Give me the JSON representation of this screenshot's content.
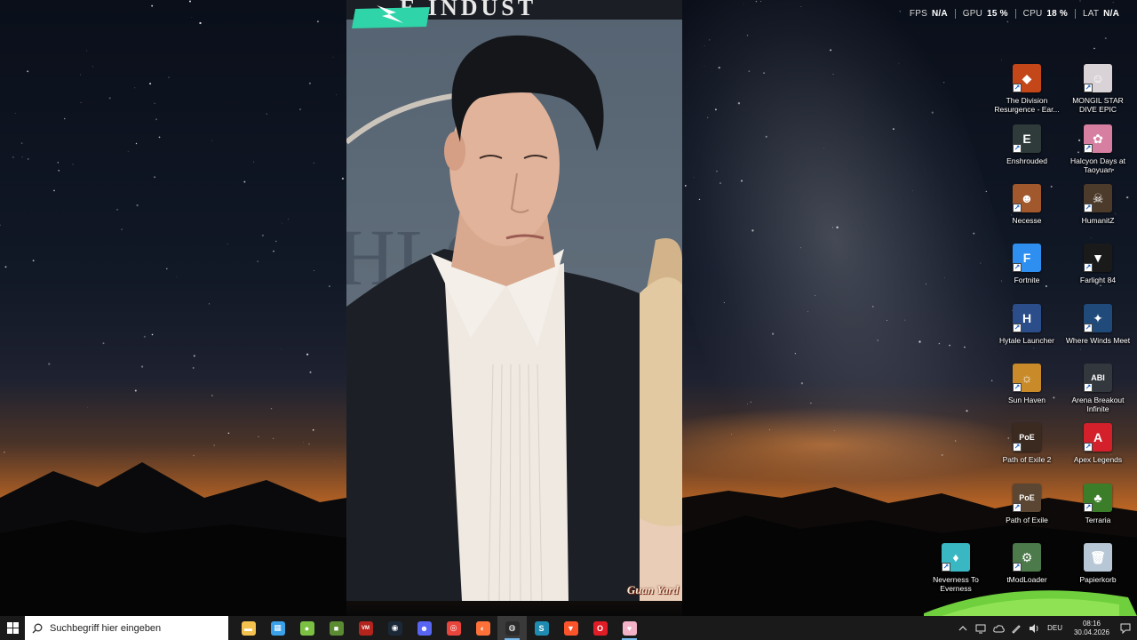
{
  "overlay": {
    "items": [
      {
        "label": "FPS",
        "value": "N/A"
      },
      {
        "label": "GPU",
        "value": "15 %"
      },
      {
        "label": "CPU",
        "value": "18 %"
      },
      {
        "label": "LAT",
        "value": "N/A"
      }
    ]
  },
  "video": {
    "banner_text": "E INDUST",
    "watermark": "Guan Yard"
  },
  "desktop_icons": [
    {
      "name": "the-division-resurgence",
      "label": "The Division Resurgence - Ear...",
      "icon": "division-icon",
      "color": "#c4471a",
      "glyph": "◆"
    },
    {
      "name": "mongil-star-dive",
      "label": "MONGIL STAR DIVE EPIC",
      "icon": "mongil-icon",
      "color": "#d9d2d6",
      "glyph": "☺"
    },
    {
      "name": "enshrouded",
      "label": "Enshrouded",
      "icon": "enshrouded-icon",
      "color": "#2e3b3a",
      "glyph": "E"
    },
    {
      "name": "halcyon-days",
      "label": "Halcyon Days at Taoyuan",
      "icon": "halcyon-icon",
      "color": "#d77fa1",
      "glyph": "✿"
    },
    {
      "name": "necesse",
      "label": "Necesse",
      "icon": "necesse-icon",
      "color": "#a0582c",
      "glyph": "☻"
    },
    {
      "name": "humanitz",
      "label": "HumanitZ",
      "icon": "humanitz-icon",
      "color": "#4c3a2a",
      "glyph": "☠"
    },
    {
      "name": "fortnite",
      "label": "Fortnite",
      "icon": "fortnite-icon",
      "color": "#2f8ff0",
      "glyph": "F"
    },
    {
      "name": "farlight-84",
      "label": "Farlight 84",
      "icon": "farlight-icon",
      "color": "#1a1a1a",
      "glyph": "▼"
    },
    {
      "name": "hytale-launcher",
      "label": "Hytale Launcher",
      "icon": "hytale-icon",
      "color": "#2b4d8a",
      "glyph": "H"
    },
    {
      "name": "where-winds-meet",
      "label": "Where Winds Meet",
      "icon": "where-winds-meet-icon",
      "color": "#1f4a7a",
      "glyph": "✦"
    },
    {
      "name": "sun-haven",
      "label": "Sun Haven",
      "icon": "sun-haven-icon",
      "color": "#c98b2a",
      "glyph": "☼"
    },
    {
      "name": "arena-breakout-infinite",
      "label": "Arena Breakout Infinite",
      "icon": "arena-breakout-icon",
      "color": "#33383f",
      "glyph": "ABI"
    },
    {
      "name": "path-of-exile-2",
      "label": "Path of Exile 2",
      "icon": "poe2-icon",
      "color": "#3b2a20",
      "glyph": "PoE"
    },
    {
      "name": "apex-legends",
      "label": "Apex Legends",
      "icon": "apex-icon",
      "color": "#d3202a",
      "glyph": "A"
    },
    {
      "name": "path-of-exile",
      "label": "Path of Exile",
      "icon": "poe-icon",
      "color": "#5a4632",
      "glyph": "PoE"
    },
    {
      "name": "terraria",
      "label": "Terraria",
      "icon": "terraria-icon",
      "color": "#3c7d2a",
      "glyph": "♣"
    },
    {
      "name": "neverness-to-everness",
      "label": "Neverness To Everness",
      "icon": "neverness-icon",
      "color": "#39b8c4",
      "glyph": "♦"
    },
    {
      "name": "tmodloader",
      "label": "tModLoader",
      "icon": "tmodloader-icon",
      "color": "#4c7a4a",
      "glyph": "⚙"
    },
    {
      "name": "papierkorb",
      "label": "Papierkorb",
      "icon": "recycle-bin-icon",
      "color": "#b8c7d6",
      "glyph": "🗑"
    }
  ],
  "taskbar": {
    "search_placeholder": "Suchbegriff hier eingeben",
    "apps": [
      {
        "name": "file-explorer",
        "icon": "folder-icon",
        "color": "#f2c14e",
        "glyph": "▬",
        "running": false
      },
      {
        "name": "microsoft-store",
        "icon": "store-icon",
        "color": "#3aa0e8",
        "glyph": "▦",
        "running": false
      },
      {
        "name": "android-app",
        "icon": "android-icon",
        "color": "#7cc043",
        "glyph": "●",
        "running": false
      },
      {
        "name": "minecraft",
        "icon": "minecraft-icon",
        "color": "#5b8c32",
        "glyph": "■",
        "running": false
      },
      {
        "name": "voicemeeter",
        "icon": "voicemeeter-icon",
        "color": "#b3241c",
        "glyph": "VM",
        "running": false
      },
      {
        "name": "steam",
        "icon": "steam-icon",
        "color": "#1b2838",
        "glyph": "◉",
        "running": false
      },
      {
        "name": "discord",
        "icon": "discord-icon",
        "color": "#5865f2",
        "glyph": "☻",
        "running": false
      },
      {
        "name": "chrome",
        "icon": "chrome-icon",
        "color": "#e8453c",
        "glyph": "◎",
        "running": false
      },
      {
        "name": "firefox",
        "icon": "firefox-icon",
        "color": "#ff7139",
        "glyph": "◐",
        "running": false
      },
      {
        "name": "obs-studio",
        "icon": "obs-icon",
        "color": "#2b2b2b",
        "glyph": "◍",
        "running": true
      },
      {
        "name": "lightning-app",
        "icon": "lightning-icon",
        "color": "#1f8bb0",
        "glyph": "S",
        "running": false
      },
      {
        "name": "brave",
        "icon": "brave-icon",
        "color": "#fb542b",
        "glyph": "▼",
        "running": false
      },
      {
        "name": "opera",
        "icon": "opera-icon",
        "color": "#e01c26",
        "glyph": "O",
        "running": false
      },
      {
        "name": "media-player",
        "icon": "media-icon",
        "color": "#f3b2c8",
        "glyph": "♥",
        "running": true
      }
    ],
    "tray": {
      "language": "DEU",
      "time": "08:16",
      "date": "30.04.2026"
    }
  }
}
